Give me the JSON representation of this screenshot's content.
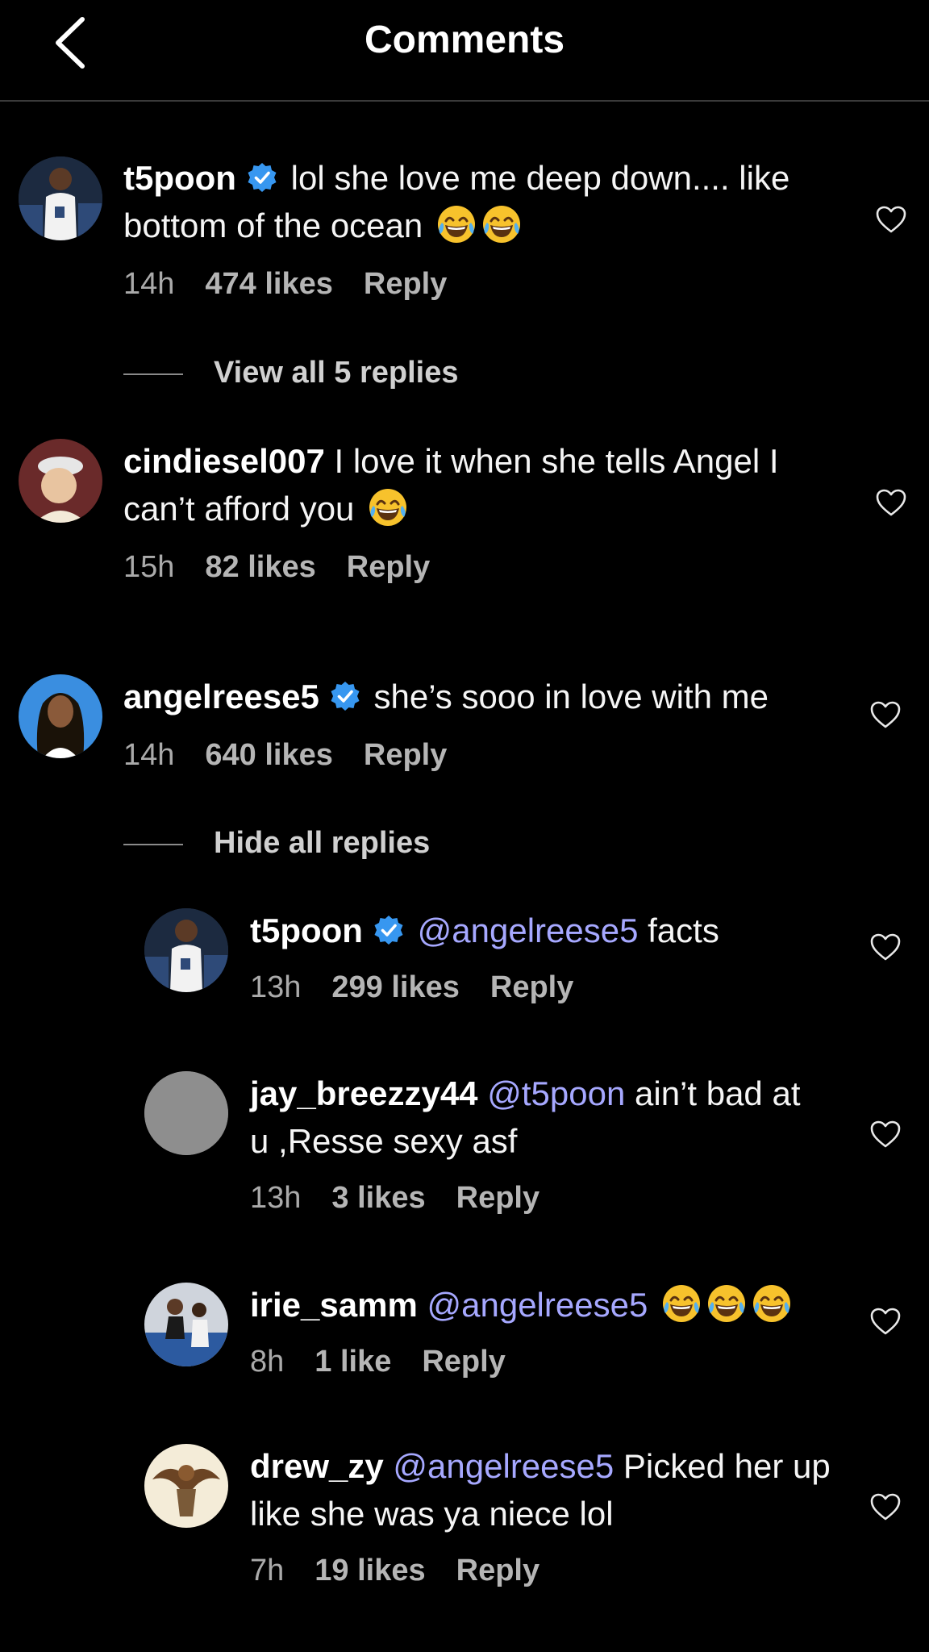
{
  "header": {
    "title": "Comments"
  },
  "comments": [
    {
      "user": "t5poon",
      "text": "lol she love me deep down.... like bottom of the ocean",
      "emojis": 2,
      "time": "14h",
      "likes": "474 likes",
      "reply": "Reply",
      "thread_label": "View all 5 replies"
    },
    {
      "user": "cindiesel007",
      "text": "I love it when she tells Angel I can’t afford you",
      "emojis": 1,
      "time": "15h",
      "likes": "82 likes",
      "reply": "Reply"
    },
    {
      "user": "angelreese5",
      "text": "she’s sooo in love with me",
      "time": "14h",
      "likes": "640 likes",
      "reply": "Reply",
      "thread_label": "Hide all replies"
    }
  ],
  "replies": [
    {
      "user": "t5poon",
      "mention": "@angelreese5",
      "text": "facts",
      "time": "13h",
      "likes": "299 likes",
      "reply": "Reply"
    },
    {
      "user": "jay_breezzy44",
      "mention": "@t5poon",
      "text": "ain’t bad at u ,Resse sexy asf",
      "time": "13h",
      "likes": "3 likes",
      "reply": "Reply"
    },
    {
      "user": "irie_samm",
      "mention": "@angelreese5",
      "text": "",
      "emojis": 3,
      "time": "8h",
      "likes": "1 like",
      "reply": "Reply"
    },
    {
      "user": "drew_zy",
      "mention": "@angelreese5",
      "text": "Picked her up like she was ya niece lol",
      "time": "7h",
      "likes": "19 likes",
      "reply": "Reply"
    }
  ],
  "colors": {
    "background": "#000000",
    "mention": "#a6a8ff",
    "verified": "#3797f0",
    "muted": "#aaaaaa"
  },
  "icons": [
    "back-arrow-icon",
    "verified-badge-icon",
    "heart-icon",
    "laughing-emoji-icon"
  ]
}
